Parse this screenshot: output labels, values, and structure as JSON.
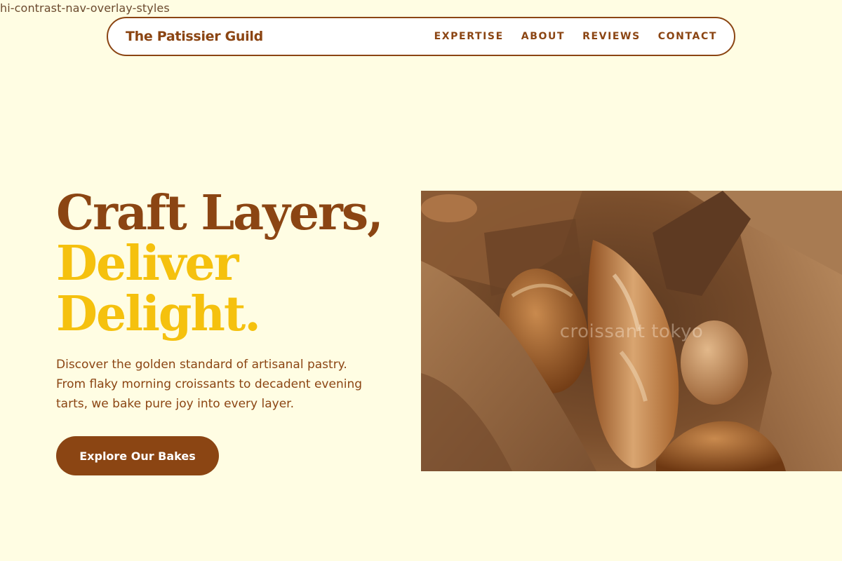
{
  "page": {
    "class_label": "hi-contrast-nav-overlay-styles"
  },
  "nav": {
    "brand": "The Patissier Guild",
    "links": [
      {
        "label": "EXPERTISE"
      },
      {
        "label": "ABOUT"
      },
      {
        "label": "REVIEWS"
      },
      {
        "label": "CONTACT"
      }
    ]
  },
  "hero": {
    "title_line1": "Craft Layers,",
    "title_line2": "Deliver",
    "title_line3": "Delight.",
    "description": "Discover the golden standard of artisanal pastry. From flaky morning croissants to decadent evening tarts, we bake pure joy into every layer.",
    "cta_label": "Explore Our Bakes",
    "image_watermark": "croissant tokyo"
  },
  "colors": {
    "background": "#FFFDE3",
    "brand_brown": "#8B4513",
    "accent_gold": "#F5C10E",
    "nav_background": "#FFFFFF",
    "cta_text": "#FFFFFF"
  }
}
